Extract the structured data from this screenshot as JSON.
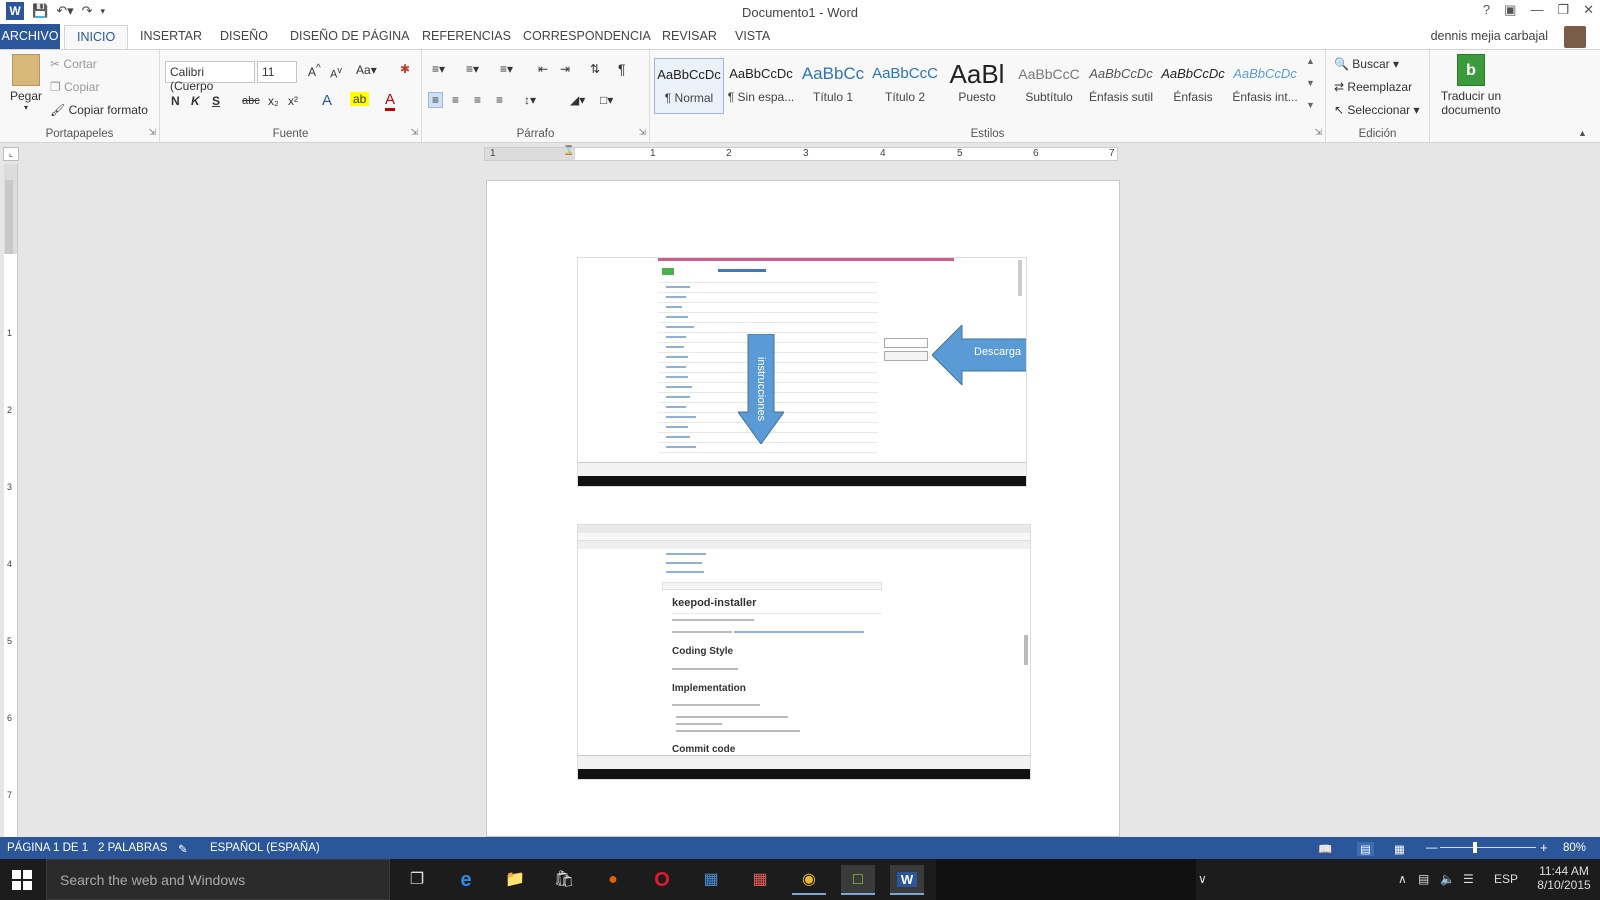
{
  "titlebar": {
    "title": "Documento1 - Word"
  },
  "tabs": {
    "file": "ARCHIVO",
    "items": [
      "INICIO",
      "INSERTAR",
      "DISEÑO",
      "DISEÑO DE PÁGINA",
      "REFERENCIAS",
      "CORRESPONDENCIA",
      "REVISAR",
      "VISTA"
    ],
    "user": "dennis mejia carbajal"
  },
  "ribbon": {
    "portapapeles": {
      "paste": "Pegar",
      "cut": "Cortar",
      "copy": "Copiar",
      "format_painter": "Copiar formato",
      "label": "Portapapeles"
    },
    "fuente": {
      "font_name": "Calibri (Cuerpo",
      "font_size": "11",
      "bold": "N",
      "italic": "K",
      "underline": "S",
      "strike": "abc",
      "sub": "x₂",
      "sup": "x²",
      "case": "Aa",
      "label": "Fuente"
    },
    "parrafo": {
      "label": "Párrafo"
    },
    "estilos": {
      "label": "Estilos",
      "items": [
        {
          "preview": "AaBbCcDc",
          "name": "¶ Normal"
        },
        {
          "preview": "AaBbCcDc",
          "name": "¶ Sin espa..."
        },
        {
          "preview": "AaBbCc",
          "name": "Título 1"
        },
        {
          "preview": "AaBbCcC",
          "name": "Título 2"
        },
        {
          "preview": "AaBl",
          "name": "Puesto"
        },
        {
          "preview": "AaBbCcC",
          "name": "Subtítulo"
        },
        {
          "preview": "AaBbCcDc",
          "name": "Énfasis sutil"
        },
        {
          "preview": "AaBbCcDc",
          "name": "Énfasis"
        },
        {
          "preview": "AaBbCcDc",
          "name": "Énfasis int..."
        }
      ]
    },
    "edicion": {
      "find": "Buscar",
      "replace": "Reemplazar",
      "select": "Seleccionar",
      "label": "Edición"
    },
    "translate": {
      "line1": "Traducir un",
      "line2": "documento"
    }
  },
  "ruler": {
    "numbers": [
      "1",
      "1",
      "2",
      "3",
      "4",
      "5",
      "6",
      "7"
    ],
    "vnumbers": [
      "1",
      "2",
      "3",
      "4",
      "5",
      "6",
      "7"
    ]
  },
  "document": {
    "arrow_down_label": "instrucciones",
    "arrow_left_label": "Descarga",
    "readme": {
      "title": "keepod-installer",
      "h2": "Coding Style",
      "h3": "Implementation",
      "h4": "Commit code"
    }
  },
  "statusbar": {
    "page": "PÁGINA 1 DE 1",
    "words": "2 PALABRAS",
    "language": "ESPAÑOL (ESPAÑA)",
    "zoom": "80%"
  },
  "taskbar": {
    "search_placeholder": "Search the web and Windows",
    "lang": "ESP",
    "time": "11:44 AM",
    "date": "8/10/2015"
  },
  "colors": {
    "word_blue": "#2b579a",
    "arrow_blue": "#5b9bd5"
  }
}
